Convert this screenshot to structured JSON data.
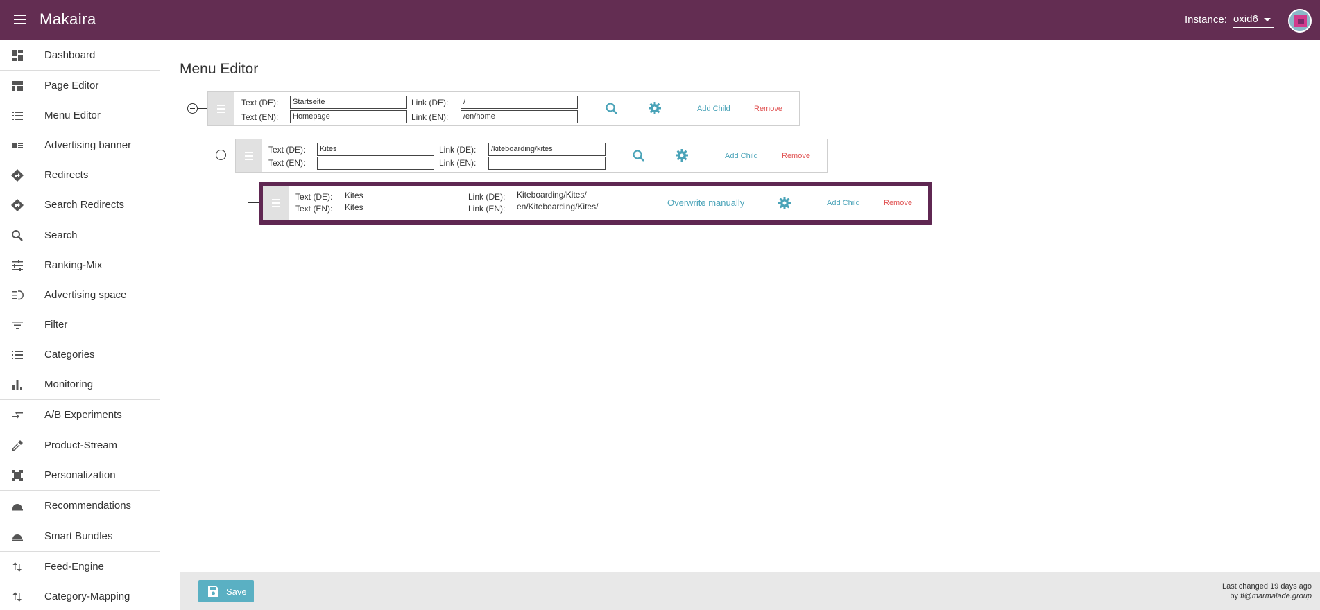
{
  "app": {
    "title": "Makaira",
    "instance_label": "Instance:",
    "instance_value": "oxid6"
  },
  "sidebar": {
    "items": [
      {
        "label": "Dashboard",
        "icon": "dashboard-icon"
      },
      {
        "label": "Page Editor",
        "icon": "page-editor-icon"
      },
      {
        "label": "Menu Editor",
        "icon": "menu-list-icon"
      },
      {
        "label": "Advertising banner",
        "icon": "banner-icon"
      },
      {
        "label": "Redirects",
        "icon": "redirect-icon"
      },
      {
        "label": "Search Redirects",
        "icon": "search-redirect-icon"
      },
      {
        "label": "Search",
        "icon": "search-icon"
      },
      {
        "label": "Ranking-Mix",
        "icon": "tune-icon"
      },
      {
        "label": "Advertising space",
        "icon": "advertising-space-icon"
      },
      {
        "label": "Filter",
        "icon": "filter-icon"
      },
      {
        "label": "Categories",
        "icon": "list-icon"
      },
      {
        "label": "Monitoring",
        "icon": "bar-chart-icon"
      },
      {
        "label": "A/B Experiments",
        "icon": "compare-arrows-icon"
      },
      {
        "label": "Product-Stream",
        "icon": "eyedropper-icon"
      },
      {
        "label": "Personalization",
        "icon": "personalization-icon"
      },
      {
        "label": "Recommendations",
        "icon": "cloche-icon"
      },
      {
        "label": "Smart Bundles",
        "icon": "cloche-icon"
      },
      {
        "label": "Feed-Engine",
        "icon": "swap-vertical-icon"
      },
      {
        "label": "Category-Mapping",
        "icon": "swap-vertical-icon"
      }
    ]
  },
  "main": {
    "title": "Menu Editor",
    "labels": {
      "text_de": "Text (DE):",
      "text_en": "Text (EN):",
      "link_de": "Link (DE):",
      "link_en": "Link (EN):",
      "add_child": "Add Child",
      "remove": "Remove",
      "overwrite": "Overwrite manually"
    },
    "nodes": [
      {
        "text_de": "Startseite",
        "text_en": "Homepage",
        "link_de": "/",
        "link_en": "/en/home"
      },
      {
        "text_de": "Kites",
        "text_en": "",
        "link_de": "/kiteboarding/kites",
        "link_en": ""
      },
      {
        "text_de": "Kites",
        "text_en": "Kites",
        "link_de": "Kiteboarding/Kites/",
        "link_en": "en/Kiteboarding/Kites/"
      }
    ]
  },
  "footer": {
    "save_label": "Save",
    "last_changed": "Last changed 19 days ago",
    "by_prefix": "by",
    "by_user": "fl@marmalade.group"
  },
  "colors": {
    "topbar": "#632d52",
    "accent": "#5ab0c3",
    "remove": "#e05050",
    "selected_border": "#5f2752"
  }
}
